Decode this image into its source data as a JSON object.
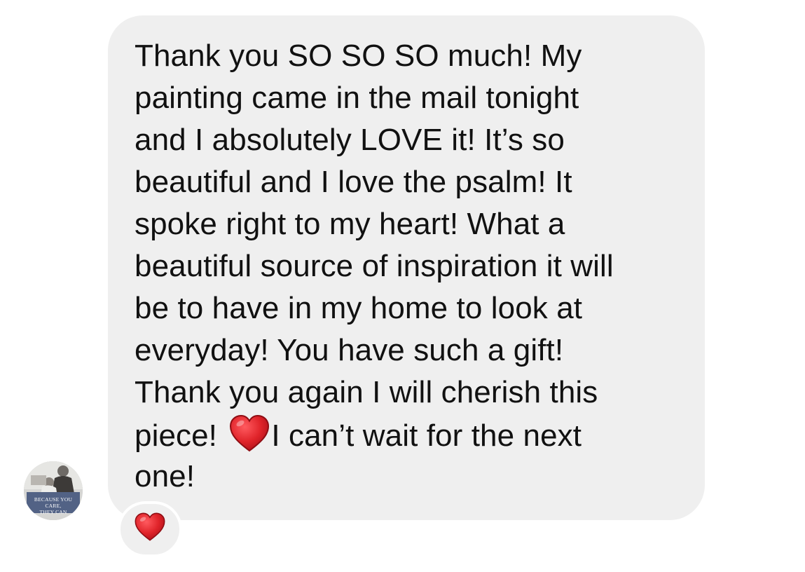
{
  "message": {
    "lines": [
      "Thank you SO SO SO much! My",
      "painting came in the mail tonight",
      "and I absolutely LOVE it! It’s so",
      "beautiful and I love the psalm! It",
      "spoke right to my heart! What a",
      "beautiful source of inspiration it will",
      "be to have in my home to look at",
      "everyday! You have such a gift!",
      "Thank you again I will cherish this"
    ],
    "line10_before_emoji": "piece! ",
    "line10_after_emoji": "I can’t wait for the next",
    "line11": "one!",
    "inline_emoji": "red-heart",
    "bubble_color": "#efefef",
    "text_color": "#111111"
  },
  "avatar": {
    "caption_line1": "BECAUSE YOU CARE,",
    "caption_line2": "THEY CAN"
  },
  "reaction": {
    "emoji": "red-heart",
    "color": "#e0242a"
  }
}
